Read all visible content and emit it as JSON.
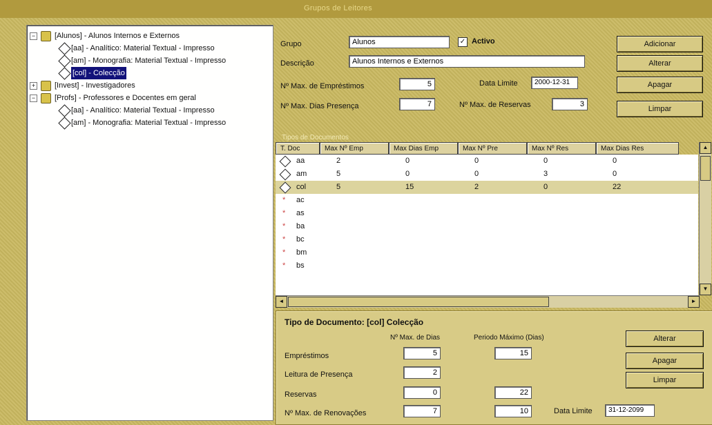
{
  "window": {
    "title": "Grupos de Leitores"
  },
  "tree": {
    "nodes": [
      {
        "expander": "−",
        "icon": "folder",
        "label": "[Alunos] - Alunos Internos e Externos",
        "level": 0
      },
      {
        "icon": "doc",
        "label": "[aa] - Analítico: Material Textual - Impresso",
        "level": 1
      },
      {
        "icon": "doc",
        "label": "[am] - Monografia: Material Textual - Impresso",
        "level": 1
      },
      {
        "icon": "doc",
        "label": "[col] - Colecção",
        "level": 1,
        "selected": true
      },
      {
        "expander": "+",
        "icon": "folder",
        "label": "[Invest] - Investigadores",
        "level": 0
      },
      {
        "expander": "−",
        "icon": "folder",
        "label": "[Profs] - Professores e Docentes em geral",
        "level": 0
      },
      {
        "icon": "doc",
        "label": "[aa] - Analítico: Material Textual - Impresso",
        "level": 1
      },
      {
        "icon": "doc",
        "label": "[am] - Monografia: Material Textual - Impresso",
        "level": 1
      }
    ]
  },
  "group": {
    "grupo_label": "Grupo",
    "grupo_value": "Alunos",
    "activo_label": "Activo",
    "activo_checked": "✓",
    "descricao_label": "Descrição",
    "descricao_value": "Alunos Internos e Externos",
    "max_emp_label": "Nº Max. de Empréstimos",
    "max_emp_value": "5",
    "data_limite_label": "Data Limite",
    "data_limite_value": "2000-12-31",
    "max_dias_pres_label": "Nº Max. Dias Presença",
    "max_dias_pres_value": "7",
    "max_reservas_label": "Nº Max. de Reservas",
    "max_reservas_value": "3",
    "buttons": {
      "adicionar": "Adicionar",
      "alterar": "Alterar",
      "apagar": "Apagar",
      "limpar": "Limpar"
    }
  },
  "doc_types": {
    "section_title": "Tipos de Documentos",
    "columns": [
      "T. Doc",
      "Max Nº Emp",
      "Max Dias Emp",
      "Max Nº Pre",
      "Max Nº Res",
      "Max Dias Res"
    ],
    "rows": [
      {
        "code": "aa",
        "values": [
          "2",
          "0",
          "0",
          "0",
          "0"
        ],
        "marker": "diamond"
      },
      {
        "code": "am",
        "values": [
          "5",
          "0",
          "0",
          "3",
          "0"
        ],
        "marker": "diamond"
      },
      {
        "code": "col",
        "values": [
          "5",
          "15",
          "2",
          "0",
          "22"
        ],
        "marker": "diamond",
        "highlight": true
      },
      {
        "code": "ac",
        "values": [
          "",
          "",
          "",
          "",
          ""
        ],
        "marker": "star"
      },
      {
        "code": "as",
        "values": [
          "",
          "",
          "",
          "",
          ""
        ],
        "marker": "star"
      },
      {
        "code": "ba",
        "values": [
          "",
          "",
          "",
          "",
          ""
        ],
        "marker": "star"
      },
      {
        "code": "bc",
        "values": [
          "",
          "",
          "",
          "",
          ""
        ],
        "marker": "star"
      },
      {
        "code": "bm",
        "values": [
          "",
          "",
          "",
          "",
          ""
        ],
        "marker": "star"
      },
      {
        "code": "bs",
        "values": [
          "",
          "",
          "",
          "",
          ""
        ],
        "marker": "star"
      }
    ]
  },
  "detail": {
    "title": "Tipo de Documento: [col] Colecção",
    "col_max_dias_label": "Nº Max. de Dias",
    "col_periodo_label": "Periodo Máximo (Dias)",
    "emprestimos_label": "Empréstimos",
    "emprestimos_dias": "5",
    "emprestimos_periodo": "15",
    "leitura_label": "Leitura de Presença",
    "leitura_dias": "2",
    "reservas_label": "Reservas",
    "reservas_dias": "0",
    "reservas_periodo": "22",
    "renovacoes_label": "Nº Max. de Renovações",
    "renovacoes_dias": "7",
    "renovacoes_periodo": "10",
    "data_limite_label": "Data Limite",
    "data_limite_value": "31-12-2099",
    "buttons": {
      "alterar": "Alterar",
      "apagar": "Apagar",
      "limpar": "Limpar"
    }
  }
}
